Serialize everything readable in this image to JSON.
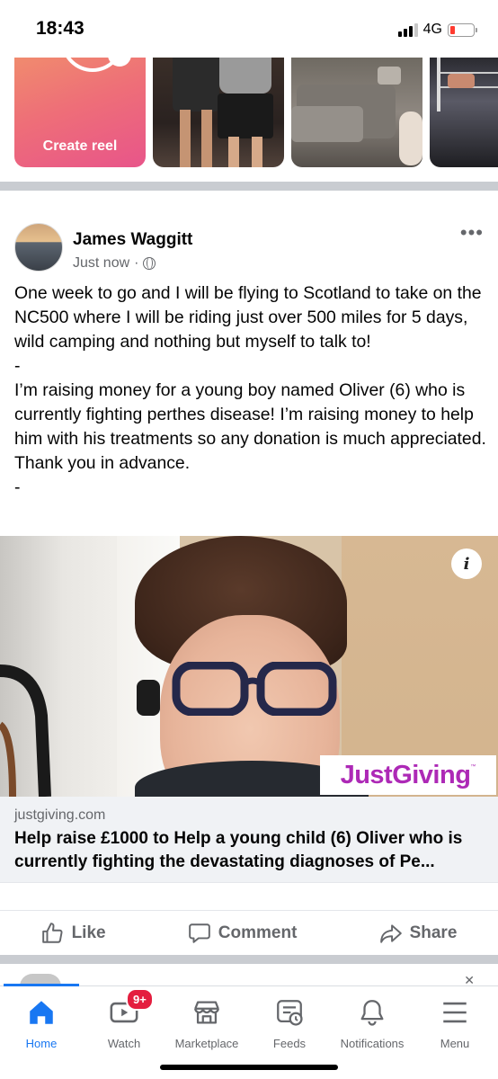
{
  "status_bar": {
    "time": "18:43",
    "network": "4G"
  },
  "reels": {
    "create_label": "Create reel"
  },
  "post": {
    "author": "James Waggitt",
    "timestamp": "Just now",
    "separator": "·",
    "more": "•••",
    "paragraphs": [
      "One week to go and I will be flying to Scotland to take on the NC500 where I will be riding just over 500 miles for 5 days, wild camping and nothing but myself to talk to!",
      "-",
      "I’m raising money for a young boy named Oliver (6) who is currently fighting perthes disease! I’m raising money to help him with his treatments so any donation is much appreciated. Thank you in advance.",
      "-"
    ],
    "link": {
      "domain": "justgiving.com",
      "title": "Help raise £1000 to Help a young child (6) Oliver who is currently fighting the devastating diagnoses of Pe...",
      "logo_text": "JustGiving",
      "logo_tm": "™",
      "info_icon": "i"
    },
    "actions": {
      "like": "Like",
      "comment": "Comment",
      "share": "Share"
    }
  },
  "tabbar": {
    "items": [
      {
        "label": "Home",
        "icon": "home-icon",
        "active": true
      },
      {
        "label": "Watch",
        "icon": "watch-icon",
        "badge": "9+"
      },
      {
        "label": "Marketplace",
        "icon": "marketplace-icon"
      },
      {
        "label": "Feeds",
        "icon": "feeds-icon"
      },
      {
        "label": "Notifications",
        "icon": "bell-icon"
      },
      {
        "label": "Menu",
        "icon": "menu-icon"
      }
    ]
  },
  "colors": {
    "accent": "#1877f2",
    "badge": "#e41e3f",
    "justgiving": "#ad29b6",
    "muted": "#65676b"
  }
}
